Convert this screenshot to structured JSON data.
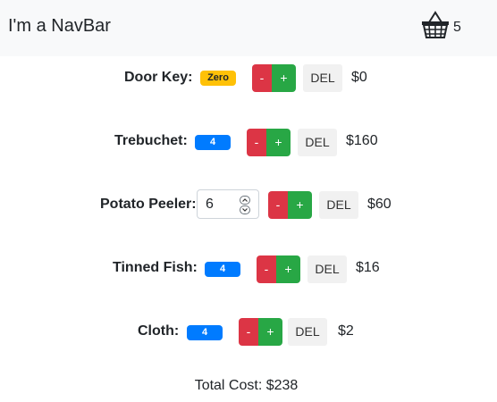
{
  "navbar": {
    "brand": "I'm a NavBar",
    "cart_icon": "basket-icon",
    "cart_count": "5"
  },
  "items": [
    {
      "label": "Door Key:",
      "quantity": "Zero",
      "minus": "-",
      "plus": "+",
      "del": "DEL",
      "price": "$0"
    },
    {
      "label": "Trebuchet:",
      "quantity": "4",
      "minus": "-",
      "plus": "+",
      "del": "DEL",
      "price": "$160"
    },
    {
      "label": "Potato Peeler:",
      "quantity": "6",
      "minus": "-",
      "plus": "+",
      "del": "DEL",
      "price": "$60"
    },
    {
      "label": "Tinned Fish:",
      "quantity": "4",
      "minus": "-",
      "plus": "+",
      "del": "DEL",
      "price": "$16"
    },
    {
      "label": "Cloth:",
      "quantity": "4",
      "minus": "-",
      "plus": "+",
      "del": "DEL",
      "price": "$2"
    }
  ],
  "total": "Total Cost: $238",
  "colors": {
    "navbar_bg": "#f8f9fa",
    "minus": "#dc3545",
    "plus": "#28a745",
    "badge_zero": "#ffc107",
    "badge_count": "#007bff",
    "del_bg": "#f1f1f1"
  }
}
